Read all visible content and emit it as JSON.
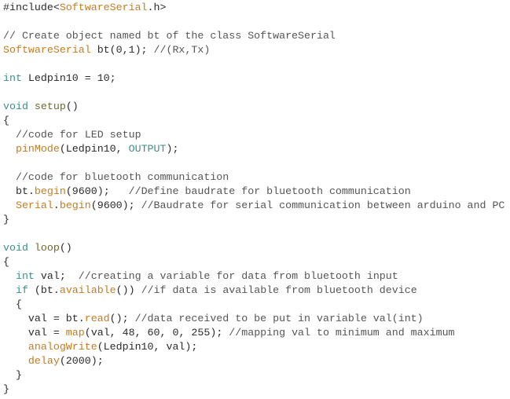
{
  "editor": {
    "language": "arduino",
    "colors": {
      "keyword": "#3b8f8a",
      "function": "#c97a1a",
      "comment": "#555555",
      "text": "#2a2a2a",
      "background": "#ffffff"
    },
    "lines": [
      [
        {
          "t": "#include<",
          "c": "plain"
        },
        {
          "t": "SoftwareSerial",
          "c": "type"
        },
        {
          "t": ".h>",
          "c": "plain"
        }
      ],
      [],
      [
        {
          "t": "// Create object named bt of the class SoftwareSerial",
          "c": "cm"
        }
      ],
      [
        {
          "t": "SoftwareSerial",
          "c": "type"
        },
        {
          "t": " bt(0,1); ",
          "c": "plain"
        },
        {
          "t": "//(Rx,Tx)",
          "c": "cm"
        }
      ],
      [],
      [
        {
          "t": "int",
          "c": "kw"
        },
        {
          "t": " Ledpin10 = 10;",
          "c": "plain"
        }
      ],
      [],
      [
        {
          "t": "void",
          "c": "kw"
        },
        {
          "t": " ",
          "c": "plain"
        },
        {
          "t": "setup",
          "c": "setup"
        },
        {
          "t": "()",
          "c": "plain"
        }
      ],
      [
        {
          "t": "{",
          "c": "plain"
        }
      ],
      [
        {
          "t": "  ",
          "c": "plain"
        },
        {
          "t": "//code for LED setup",
          "c": "cm"
        }
      ],
      [
        {
          "t": "  ",
          "c": "plain"
        },
        {
          "t": "pinMode",
          "c": "fn"
        },
        {
          "t": "(Ledpin10, ",
          "c": "plain"
        },
        {
          "t": "OUTPUT",
          "c": "const"
        },
        {
          "t": ");",
          "c": "plain"
        }
      ],
      [],
      [
        {
          "t": "  ",
          "c": "plain"
        },
        {
          "t": "//code for bluetooth communication",
          "c": "cm"
        }
      ],
      [
        {
          "t": "  bt.",
          "c": "plain"
        },
        {
          "t": "begin",
          "c": "fn"
        },
        {
          "t": "(9600);   ",
          "c": "plain"
        },
        {
          "t": "//Define baudrate for bluetooth communication",
          "c": "cm"
        }
      ],
      [
        {
          "t": "  ",
          "c": "plain"
        },
        {
          "t": "Serial",
          "c": "type"
        },
        {
          "t": ".",
          "c": "plain"
        },
        {
          "t": "begin",
          "c": "fn"
        },
        {
          "t": "(9600); ",
          "c": "plain"
        },
        {
          "t": "//Baudrate for serial communication between arduino and PC",
          "c": "cm"
        }
      ],
      [
        {
          "t": "}",
          "c": "plain"
        }
      ],
      [],
      [
        {
          "t": "void",
          "c": "kw"
        },
        {
          "t": " ",
          "c": "plain"
        },
        {
          "t": "loop",
          "c": "setup"
        },
        {
          "t": "()",
          "c": "plain"
        }
      ],
      [
        {
          "t": "{",
          "c": "plain"
        }
      ],
      [
        {
          "t": "  ",
          "c": "plain"
        },
        {
          "t": "int",
          "c": "kw"
        },
        {
          "t": " val;  ",
          "c": "plain"
        },
        {
          "t": "//creating a variable for data from bluetooth input",
          "c": "cm"
        }
      ],
      [
        {
          "t": "  ",
          "c": "plain"
        },
        {
          "t": "if",
          "c": "kw"
        },
        {
          "t": " (bt.",
          "c": "plain"
        },
        {
          "t": "available",
          "c": "fn"
        },
        {
          "t": "()) ",
          "c": "plain"
        },
        {
          "t": "//if data is available from bluetooth device",
          "c": "cm"
        }
      ],
      [
        {
          "t": "  {",
          "c": "plain"
        }
      ],
      [
        {
          "t": "    val = bt.",
          "c": "plain"
        },
        {
          "t": "read",
          "c": "fn"
        },
        {
          "t": "(); ",
          "c": "plain"
        },
        {
          "t": "//data received to be put in variable val(int)",
          "c": "cm"
        }
      ],
      [
        {
          "t": "    val = ",
          "c": "plain"
        },
        {
          "t": "map",
          "c": "fn"
        },
        {
          "t": "(val, 48, 60, 0, 255); ",
          "c": "plain"
        },
        {
          "t": "//mapping val to minimum and maximum",
          "c": "cm"
        }
      ],
      [
        {
          "t": "    ",
          "c": "plain"
        },
        {
          "t": "analogWrite",
          "c": "fn"
        },
        {
          "t": "(Ledpin10, val);",
          "c": "plain"
        }
      ],
      [
        {
          "t": "    ",
          "c": "plain"
        },
        {
          "t": "delay",
          "c": "fn"
        },
        {
          "t": "(2000);",
          "c": "plain"
        }
      ],
      [
        {
          "t": "  }",
          "c": "plain"
        }
      ],
      [
        {
          "t": "}",
          "c": "plain"
        }
      ]
    ]
  }
}
